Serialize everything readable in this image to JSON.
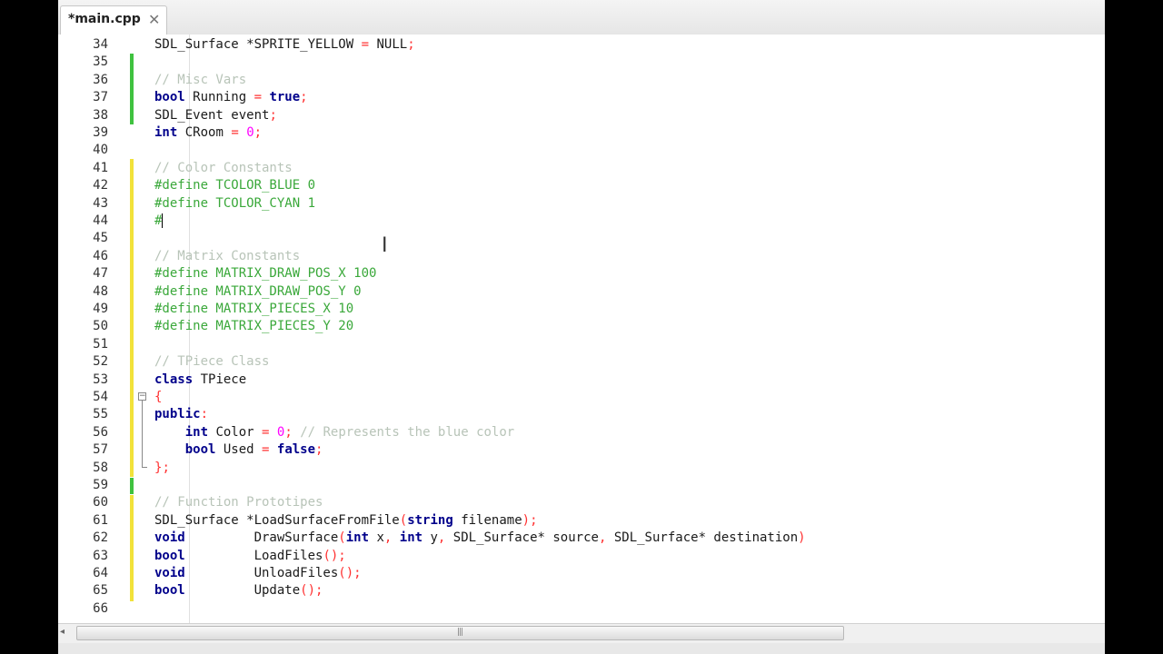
{
  "tab": {
    "label": "*main.cpp",
    "close": "✕"
  },
  "editor": {
    "caret_line": "44",
    "lines": [
      {
        "n": "34",
        "t": [
          [
            "SDL_Surface ",
            ""
          ],
          [
            "*",
            ""
          ],
          [
            "SPRITE_YELLOW ",
            ""
          ],
          [
            "= ",
            "op"
          ],
          [
            "NULL",
            ""
          ],
          [
            ";",
            "op"
          ]
        ]
      },
      {
        "n": "35",
        "t": []
      },
      {
        "n": "36",
        "t": [
          [
            "// Misc Vars",
            "cm"
          ]
        ]
      },
      {
        "n": "37",
        "t": [
          [
            "bool",
            "kw"
          ],
          [
            " Running ",
            ""
          ],
          [
            "=",
            "op"
          ],
          [
            " ",
            ""
          ],
          [
            "true",
            "kw"
          ],
          [
            ";",
            "op"
          ]
        ]
      },
      {
        "n": "38",
        "t": [
          [
            "SDL_Event event",
            ""
          ],
          [
            ";",
            "op"
          ]
        ]
      },
      {
        "n": "39",
        "t": [
          [
            "int",
            "kw"
          ],
          [
            " CRoom ",
            ""
          ],
          [
            "=",
            "op"
          ],
          [
            " ",
            ""
          ],
          [
            "0",
            "num"
          ],
          [
            ";",
            "op"
          ]
        ]
      },
      {
        "n": "40",
        "t": []
      },
      {
        "n": "41",
        "t": [
          [
            "// Color Constants",
            "cm"
          ]
        ]
      },
      {
        "n": "42",
        "t": [
          [
            "#define TCOLOR_BLUE 0",
            "pp"
          ]
        ]
      },
      {
        "n": "43",
        "t": [
          [
            "#define TCOLOR_CYAN 1",
            "pp"
          ]
        ]
      },
      {
        "n": "44",
        "t": [
          [
            "#",
            "pp"
          ]
        ]
      },
      {
        "n": "45",
        "t": []
      },
      {
        "n": "46",
        "t": [
          [
            "// Matrix Constants",
            "cm"
          ]
        ]
      },
      {
        "n": "47",
        "t": [
          [
            "#define MATRIX_DRAW_POS_X 100",
            "pp"
          ]
        ]
      },
      {
        "n": "48",
        "t": [
          [
            "#define MATRIX_DRAW_POS_Y 0",
            "pp"
          ]
        ]
      },
      {
        "n": "49",
        "t": [
          [
            "#define MATRIX_PIECES_X 10",
            "pp"
          ]
        ]
      },
      {
        "n": "50",
        "t": [
          [
            "#define MATRIX_PIECES_Y 20",
            "pp"
          ]
        ]
      },
      {
        "n": "51",
        "t": []
      },
      {
        "n": "52",
        "t": [
          [
            "// TPiece Class",
            "cm"
          ]
        ]
      },
      {
        "n": "53",
        "t": [
          [
            "class",
            "kw"
          ],
          [
            " TPiece",
            ""
          ]
        ]
      },
      {
        "n": "54",
        "t": [
          [
            "{",
            "op"
          ]
        ]
      },
      {
        "n": "55",
        "t": [
          [
            "public",
            "kw"
          ],
          [
            ":",
            "op"
          ]
        ]
      },
      {
        "n": "56",
        "t": [
          [
            "    ",
            ""
          ],
          [
            "int",
            "kw"
          ],
          [
            " Color ",
            ""
          ],
          [
            "=",
            "op"
          ],
          [
            " ",
            ""
          ],
          [
            "0",
            "num"
          ],
          [
            ";",
            "op"
          ],
          [
            " ",
            ""
          ],
          [
            "// Represents the blue color",
            "cm"
          ]
        ]
      },
      {
        "n": "57",
        "t": [
          [
            "    ",
            ""
          ],
          [
            "bool",
            "kw"
          ],
          [
            " Used ",
            ""
          ],
          [
            "=",
            "op"
          ],
          [
            " ",
            ""
          ],
          [
            "false",
            "kw"
          ],
          [
            ";",
            "op"
          ]
        ]
      },
      {
        "n": "58",
        "t": [
          [
            "}",
            "op"
          ],
          [
            ";",
            "op"
          ]
        ]
      },
      {
        "n": "59",
        "t": []
      },
      {
        "n": "60",
        "t": [
          [
            "// Function Prototipes",
            "cm"
          ]
        ]
      },
      {
        "n": "61",
        "t": [
          [
            "SDL_Surface ",
            ""
          ],
          [
            "*",
            ""
          ],
          [
            "LoadSurfaceFromFile",
            ""
          ],
          [
            "(",
            "op"
          ],
          [
            "string",
            "kw"
          ],
          [
            " filename",
            ""
          ],
          [
            ")",
            "op"
          ],
          [
            ";",
            "op"
          ]
        ]
      },
      {
        "n": "62",
        "t": [
          [
            "void",
            "kw"
          ],
          [
            "         DrawSurface",
            ""
          ],
          [
            "(",
            "op"
          ],
          [
            "int",
            "kw"
          ],
          [
            " x",
            ""
          ],
          [
            ",",
            "op"
          ],
          [
            " ",
            ""
          ],
          [
            "int",
            "kw"
          ],
          [
            " y",
            ""
          ],
          [
            ",",
            "op"
          ],
          [
            " SDL_Surface",
            ""
          ],
          [
            "*",
            ""
          ],
          [
            " source",
            ""
          ],
          [
            ",",
            "op"
          ],
          [
            " SDL_Surface",
            ""
          ],
          [
            "*",
            ""
          ],
          [
            " destination",
            ""
          ],
          [
            ")",
            "op"
          ]
        ]
      },
      {
        "n": "63",
        "t": [
          [
            "bool",
            "kw"
          ],
          [
            "         LoadFiles",
            ""
          ],
          [
            "()",
            "op"
          ],
          [
            ";",
            "op"
          ]
        ]
      },
      {
        "n": "64",
        "t": [
          [
            "void",
            "kw"
          ],
          [
            "         UnloadFiles",
            ""
          ],
          [
            "()",
            "op"
          ],
          [
            ";",
            "op"
          ]
        ]
      },
      {
        "n": "65",
        "t": [
          [
            "bool",
            "kw"
          ],
          [
            "         Update",
            ""
          ],
          [
            "()",
            "op"
          ],
          [
            ";",
            "op"
          ]
        ]
      },
      {
        "n": "66",
        "t": []
      }
    ]
  },
  "colors": {
    "change_green": "#3fc23f",
    "change_yellow": "#f2e23a"
  },
  "scrollbar": {
    "left_arrow": "◂",
    "grip": "|||"
  }
}
